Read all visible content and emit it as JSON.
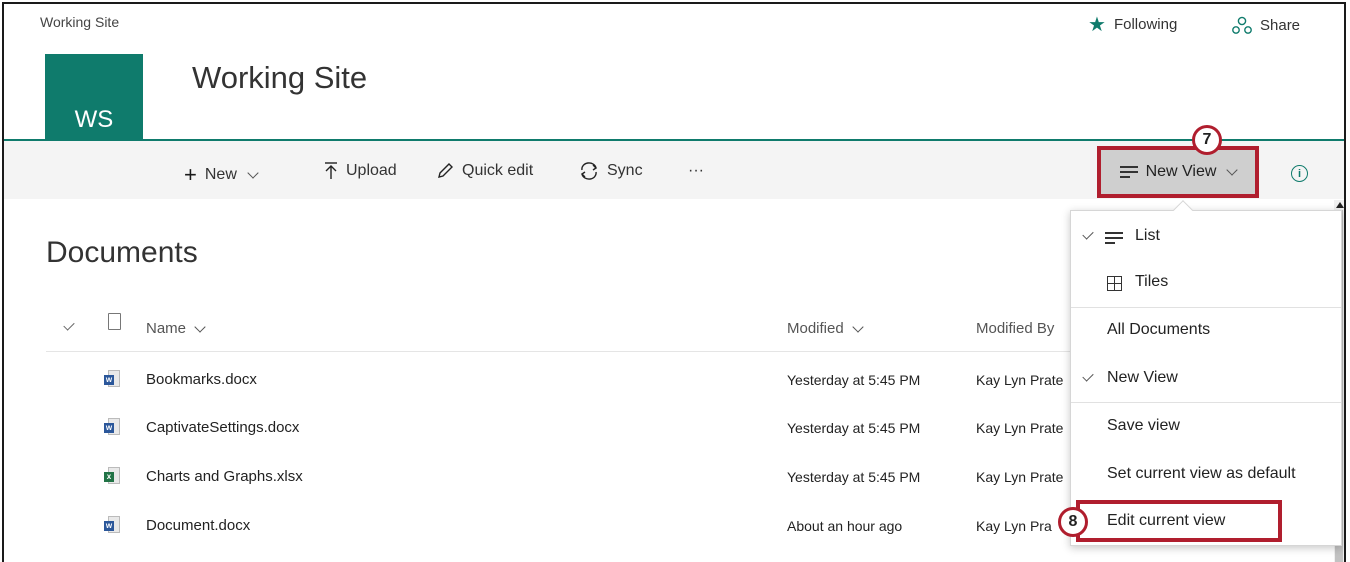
{
  "suite": {
    "site_crumb": "Working Site",
    "following_label": "Following",
    "share_label": "Share"
  },
  "header": {
    "logo_text": "WS",
    "site_title": "Working Site"
  },
  "command_bar": {
    "new_label": "New",
    "upload_label": "Upload",
    "quick_edit_label": "Quick edit",
    "sync_label": "Sync",
    "more_label": "···",
    "view_label": "New View"
  },
  "annotations": {
    "step_7": "7",
    "step_8": "8"
  },
  "library": {
    "title": "Documents",
    "columns": {
      "name": "Name",
      "modified": "Modified",
      "modified_by": "Modified By"
    },
    "rows": [
      {
        "name": "Bookmarks.docx",
        "type": "word",
        "modified": "Yesterday at 5:45 PM",
        "modified_by": "Kay Lyn Prate"
      },
      {
        "name": "CaptivateSettings.docx",
        "type": "word",
        "modified": "Yesterday at 5:45 PM",
        "modified_by": "Kay Lyn Prate"
      },
      {
        "name": "Charts and Graphs.xlsx",
        "type": "excel",
        "modified": "Yesterday at 5:45 PM",
        "modified_by": "Kay Lyn Prate"
      },
      {
        "name": "Document.docx",
        "type": "word",
        "modified": "About an hour ago",
        "modified_by": "Kay Lyn Pra"
      }
    ]
  },
  "view_menu": {
    "list_label": "List",
    "tiles_label": "Tiles",
    "all_documents_label": "All Documents",
    "new_view_label": "New View",
    "save_view_label": "Save view",
    "set_default_label": "Set current view as default",
    "edit_view_label": "Edit current view"
  },
  "colors": {
    "brand": "#0f7b6c",
    "highlight": "#b01e2e",
    "word": "#2b579a",
    "excel": "#217346"
  }
}
